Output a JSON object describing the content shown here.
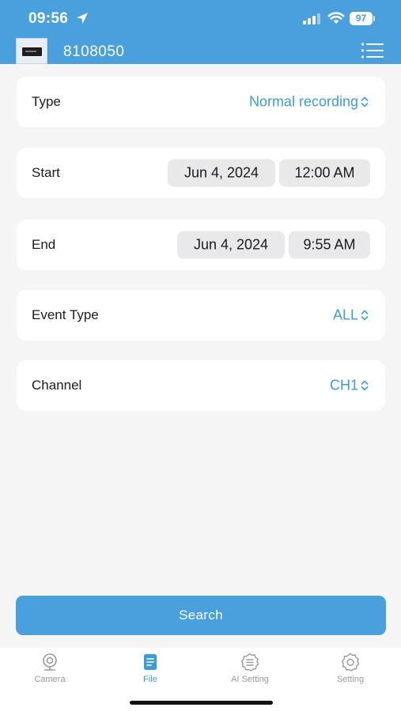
{
  "status_bar": {
    "time": "09:56",
    "battery": "97"
  },
  "header": {
    "device_id": "8108050",
    "menu_icon": "list-menu-icon"
  },
  "form": {
    "type": {
      "label": "Type",
      "value": "Normal recording"
    },
    "start": {
      "label": "Start",
      "date": "Jun 4, 2024",
      "time": "12:00 AM"
    },
    "end": {
      "label": "End",
      "date": "Jun 4, 2024",
      "time": "9:55 AM"
    },
    "event_type": {
      "label": "Event Type",
      "value": "ALL"
    },
    "channel": {
      "label": "Channel",
      "value": "CH1"
    }
  },
  "search_label": "Search",
  "tabs": [
    {
      "label": "Camera",
      "icon": "camera-icon",
      "active": false
    },
    {
      "label": "File",
      "icon": "file-icon",
      "active": true
    },
    {
      "label": "AI Setting",
      "icon": "ai-setting-icon",
      "active": false
    },
    {
      "label": "Setting",
      "icon": "gear-icon",
      "active": false
    }
  ],
  "colors": {
    "accent": "#4aa0dc",
    "link": "#3d9bd6",
    "background": "#f5f5f6",
    "inactive_tab": "#9a9a9a"
  }
}
